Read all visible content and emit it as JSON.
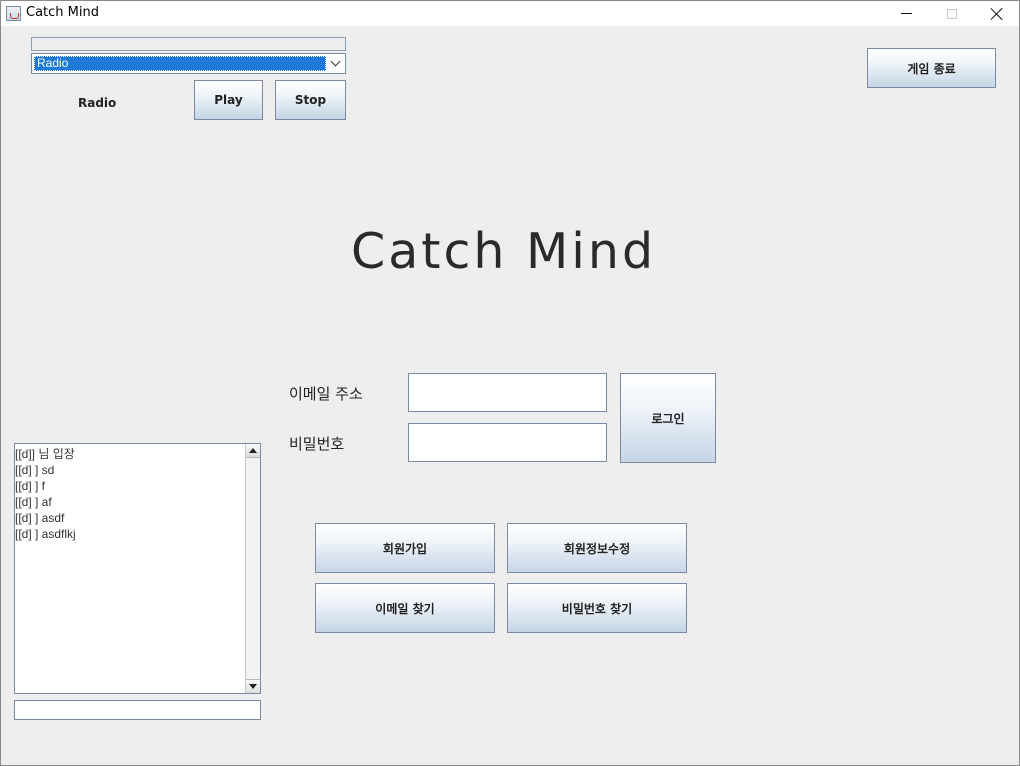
{
  "window": {
    "title": "Catch Mind",
    "minimize_icon": "minimize-icon",
    "maximize_icon": "maximize-icon",
    "close_icon": "close-icon"
  },
  "radio": {
    "selected": "Radio",
    "label": "Radio",
    "play_label": "Play",
    "stop_label": "Stop"
  },
  "header": {
    "exit_label": "게임 종료"
  },
  "main": {
    "title": "Catch Mind"
  },
  "login": {
    "email_label": "이메일 주소",
    "email_value": "",
    "password_label": "비밀번호",
    "password_value": "",
    "login_label": "로그인"
  },
  "actions": {
    "signup_label": "회원가입",
    "edit_info_label": "회원정보수정",
    "find_email_label": "이메일 찾기",
    "find_password_label": "비밀번호 찾기"
  },
  "chat": {
    "lines": [
      "[[d]]  님 입장",
      "[[d] ] sd",
      "[[d] ] f",
      "[[d] ] af",
      "[[d] ] asdf",
      "[[d] ] asdflkj"
    ],
    "input_value": ""
  },
  "colors": {
    "background": "#eeeeee",
    "selection": "#1e78d6",
    "button_border": "#7a8aa0"
  }
}
